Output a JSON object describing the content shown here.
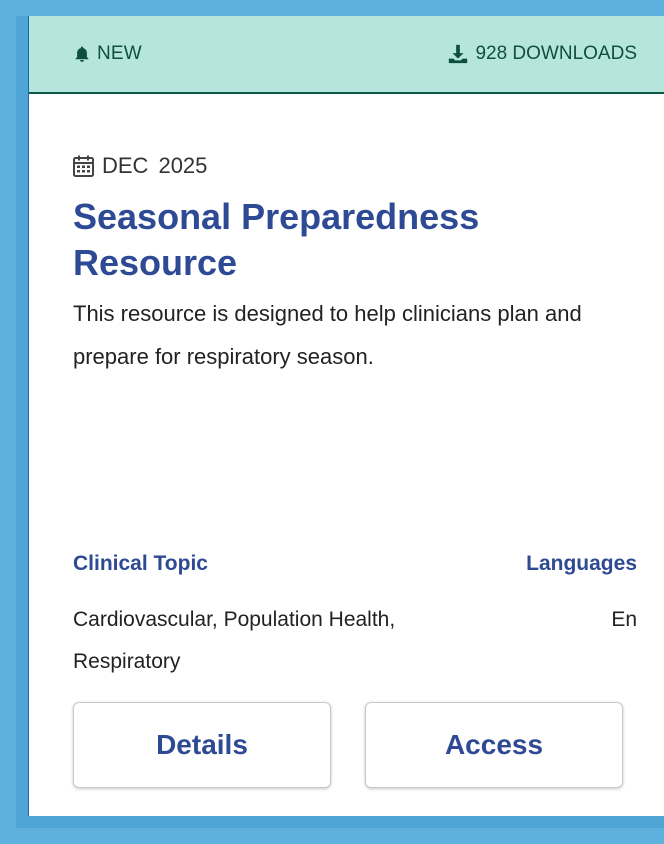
{
  "badges": {
    "new_label": "NEW",
    "new_icon": "bell-icon",
    "downloads_label": "928 DOWNLOADS",
    "downloads_icon": "download-icon"
  },
  "date": {
    "icon": "calendar-icon",
    "month": "DEC",
    "year": "2025"
  },
  "title": "Seasonal Preparedness Resource",
  "description": "This resource is designed to help clinicians plan and prepare for respiratory season.",
  "meta": {
    "topic_label": "Clinical Topic",
    "topic_value": "Cardiovascular, Population Health, Respiratory",
    "languages_label": "Languages",
    "languages_value": "En"
  },
  "actions": {
    "details_label": "Details",
    "access_label": "Access"
  },
  "colors": {
    "header_bg": "#b6e5dd",
    "header_text": "#0f4f40",
    "title": "#2e4a94",
    "frame": "#5fb1dd"
  }
}
